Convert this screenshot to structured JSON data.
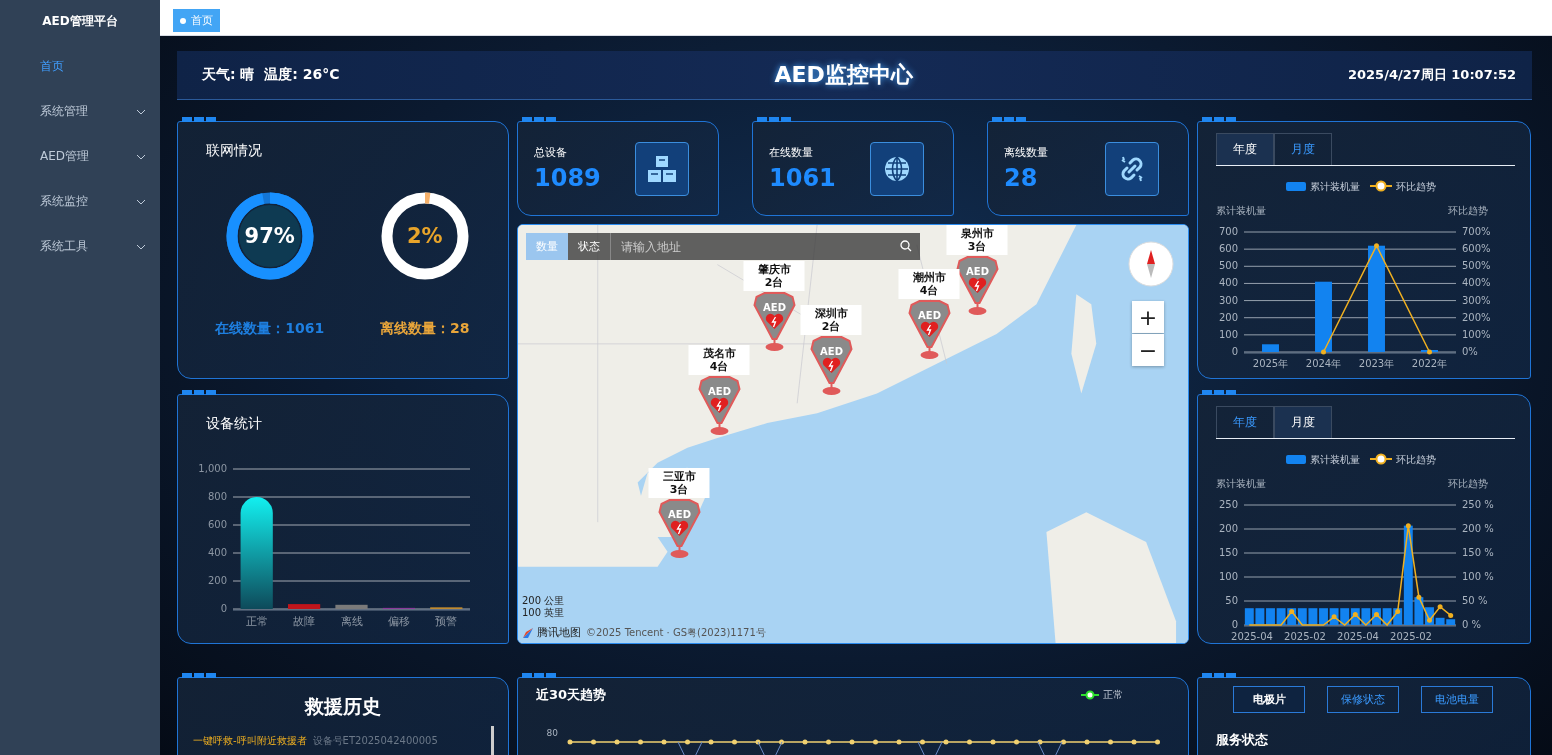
{
  "sidebar": {
    "title": "AED管理平台",
    "items": [
      {
        "label": "首页",
        "selected": true,
        "expandable": false
      },
      {
        "label": "系统管理",
        "selected": false,
        "expandable": true
      },
      {
        "label": "AED管理",
        "selected": false,
        "expandable": true
      },
      {
        "label": "系统监控",
        "selected": false,
        "expandable": true
      },
      {
        "label": "系统工具",
        "selected": false,
        "expandable": true
      }
    ]
  },
  "page_tabs": [
    {
      "label": "首页",
      "selected": true
    }
  ],
  "header": {
    "weather": "天气: 晴  温度: 26°C",
    "title": "AED监控中心",
    "datetime": "2025/4/27周日 10:07:52"
  },
  "network": {
    "title": "联网情况",
    "rings": [
      {
        "kind": "online",
        "value": "97%",
        "level": 0.97,
        "caption": "在线数量：1061"
      },
      {
        "kind": "offline",
        "value": "2%",
        "level": 0.02,
        "caption": "离线数量：28"
      }
    ]
  },
  "device_stats": {
    "title": "设备统计",
    "chart_data": {
      "type": "bar",
      "categories": [
        "正常",
        "故障",
        "离线",
        "偏移",
        "预警"
      ],
      "values": [
        800,
        35,
        30,
        8,
        12
      ],
      "grid": true,
      "ylim": [
        0,
        1000
      ],
      "yticks": [
        0,
        200,
        400,
        600,
        800,
        {
          "value": 1000,
          "label": "1,000"
        }
      ]
    }
  },
  "stat_cards": [
    {
      "kind": "boxes",
      "label": "总设备",
      "value": "1089"
    },
    {
      "kind": "globe",
      "label": "在线数量",
      "value": "1061"
    },
    {
      "kind": "link",
      "label": "离线数量",
      "value": "28"
    }
  ],
  "map": {
    "tabs": [
      {
        "label": "数量",
        "selected": true
      },
      {
        "label": "状态",
        "selected": false
      }
    ],
    "search": {
      "placeholder": "请输入地址"
    },
    "markers": [
      {
        "city": "泉州市",
        "count": "3台",
        "badge": "AED"
      },
      {
        "city": "肇庆市",
        "count": "2台",
        "badge": "AED"
      },
      {
        "city": "潮州市",
        "count": "4台",
        "badge": "AED"
      },
      {
        "city": "深圳市",
        "count": "2台",
        "badge": "AED"
      },
      {
        "city": "茂名市",
        "count": "4台",
        "badge": "AED"
      },
      {
        "city": "三亚市",
        "count": "3台",
        "badge": "AED"
      }
    ],
    "zoom_in": "+",
    "zoom_out": "−",
    "scale": [
      "200 公里",
      "100 英里"
    ],
    "logo": "腾讯地图",
    "copyright": "©2025 Tencent · GS粤(2023)1171号"
  },
  "install_panels": [
    {
      "tabs": [
        {
          "label": "年度",
          "selected": true
        },
        {
          "label": "月度",
          "selected": false
        }
      ],
      "chart_data": {
        "type": "bar",
        "ylabel": "累计装机量",
        "y2label": "环比趋势",
        "categories": [
          "2025年",
          "2024年",
          "2023年",
          "2022年"
        ],
        "series": [
          {
            "name": "累计装机量",
            "color": "#1283f0",
            "type": "bar",
            "values": [
              45,
              410,
              620,
              5
            ]
          },
          {
            "name": "环比趋势",
            "color": "#f0b020",
            "type": "line",
            "values": [
              null,
              0,
              620,
              0
            ]
          }
        ],
        "legend": "top",
        "grid": true,
        "ylim": [
          0,
          700
        ],
        "yticks": [
          0,
          100,
          200,
          300,
          400,
          500,
          600,
          700
        ],
        "y2lim": [
          0,
          700
        ],
        "y2ticks": [
          {
            "value": 0,
            "label": "0%"
          },
          {
            "value": 100,
            "label": "100%"
          },
          {
            "value": 200,
            "label": "200%"
          },
          {
            "value": 300,
            "label": "300%"
          },
          {
            "value": 400,
            "label": "400%"
          },
          {
            "value": 500,
            "label": "500%"
          },
          {
            "value": 600,
            "label": "600%"
          },
          {
            "value": 700,
            "label": "700%"
          }
        ]
      }
    },
    {
      "tabs": [
        {
          "label": "年度",
          "selected": false
        },
        {
          "label": "月度",
          "selected": true
        }
      ],
      "chart_data": {
        "type": "bar",
        "ylabel": "累计装机量",
        "y2label": "环比趋势",
        "categories": [
          "2025-04",
          null,
          null,
          null,
          null,
          "2025-02",
          null,
          null,
          null,
          null,
          "2025-04",
          null,
          null,
          null,
          null,
          "2025-02",
          null,
          null,
          null,
          null
        ],
        "series": [
          {
            "name": "累计装机量",
            "color": "#1283f0",
            "type": "bar",
            "values": [
              35,
              35,
              35,
              35,
              35,
              35,
              35,
              35,
              35,
              35,
              35,
              35,
              35,
              35,
              35,
              207,
              58,
              37,
              15,
              12
            ]
          },
          {
            "name": "环比趋势",
            "color": "#f0b020",
            "type": "line",
            "values": [
              0,
              0,
              0,
              0,
              28,
              0,
              0,
              0,
              17,
              0,
              22,
              0,
              22,
              0,
              28,
              207,
              58,
              10,
              38,
              20
            ]
          }
        ],
        "legend": "top",
        "grid": true,
        "ylim": [
          0,
          250
        ],
        "yticks": [
          0,
          50,
          100,
          150,
          200,
          250
        ],
        "y2lim": [
          0,
          250
        ],
        "y2ticks": [
          {
            "value": 0,
            "label": "0 %"
          },
          {
            "value": 50,
            "label": "50 %"
          },
          {
            "value": 100,
            "label": "100 %"
          },
          {
            "value": 150,
            "label": "150 %"
          },
          {
            "value": 200,
            "label": "200 %"
          },
          {
            "value": 250,
            "label": "250 %"
          }
        ]
      }
    }
  ],
  "rescue": {
    "title": "救援历史",
    "entries": [
      {
        "event": "一键呼救-呼叫附近救援者",
        "device": "设备号ET2025042400005"
      }
    ]
  },
  "trend": {
    "title": "近30天趋势",
    "legend": "正常",
    "tick": "80"
  },
  "service": {
    "buttons": [
      {
        "label": "电极片",
        "selected": true
      },
      {
        "label": "保修状态",
        "selected": false
      },
      {
        "label": "电池电量",
        "selected": false
      }
    ],
    "title": "服务状态"
  }
}
